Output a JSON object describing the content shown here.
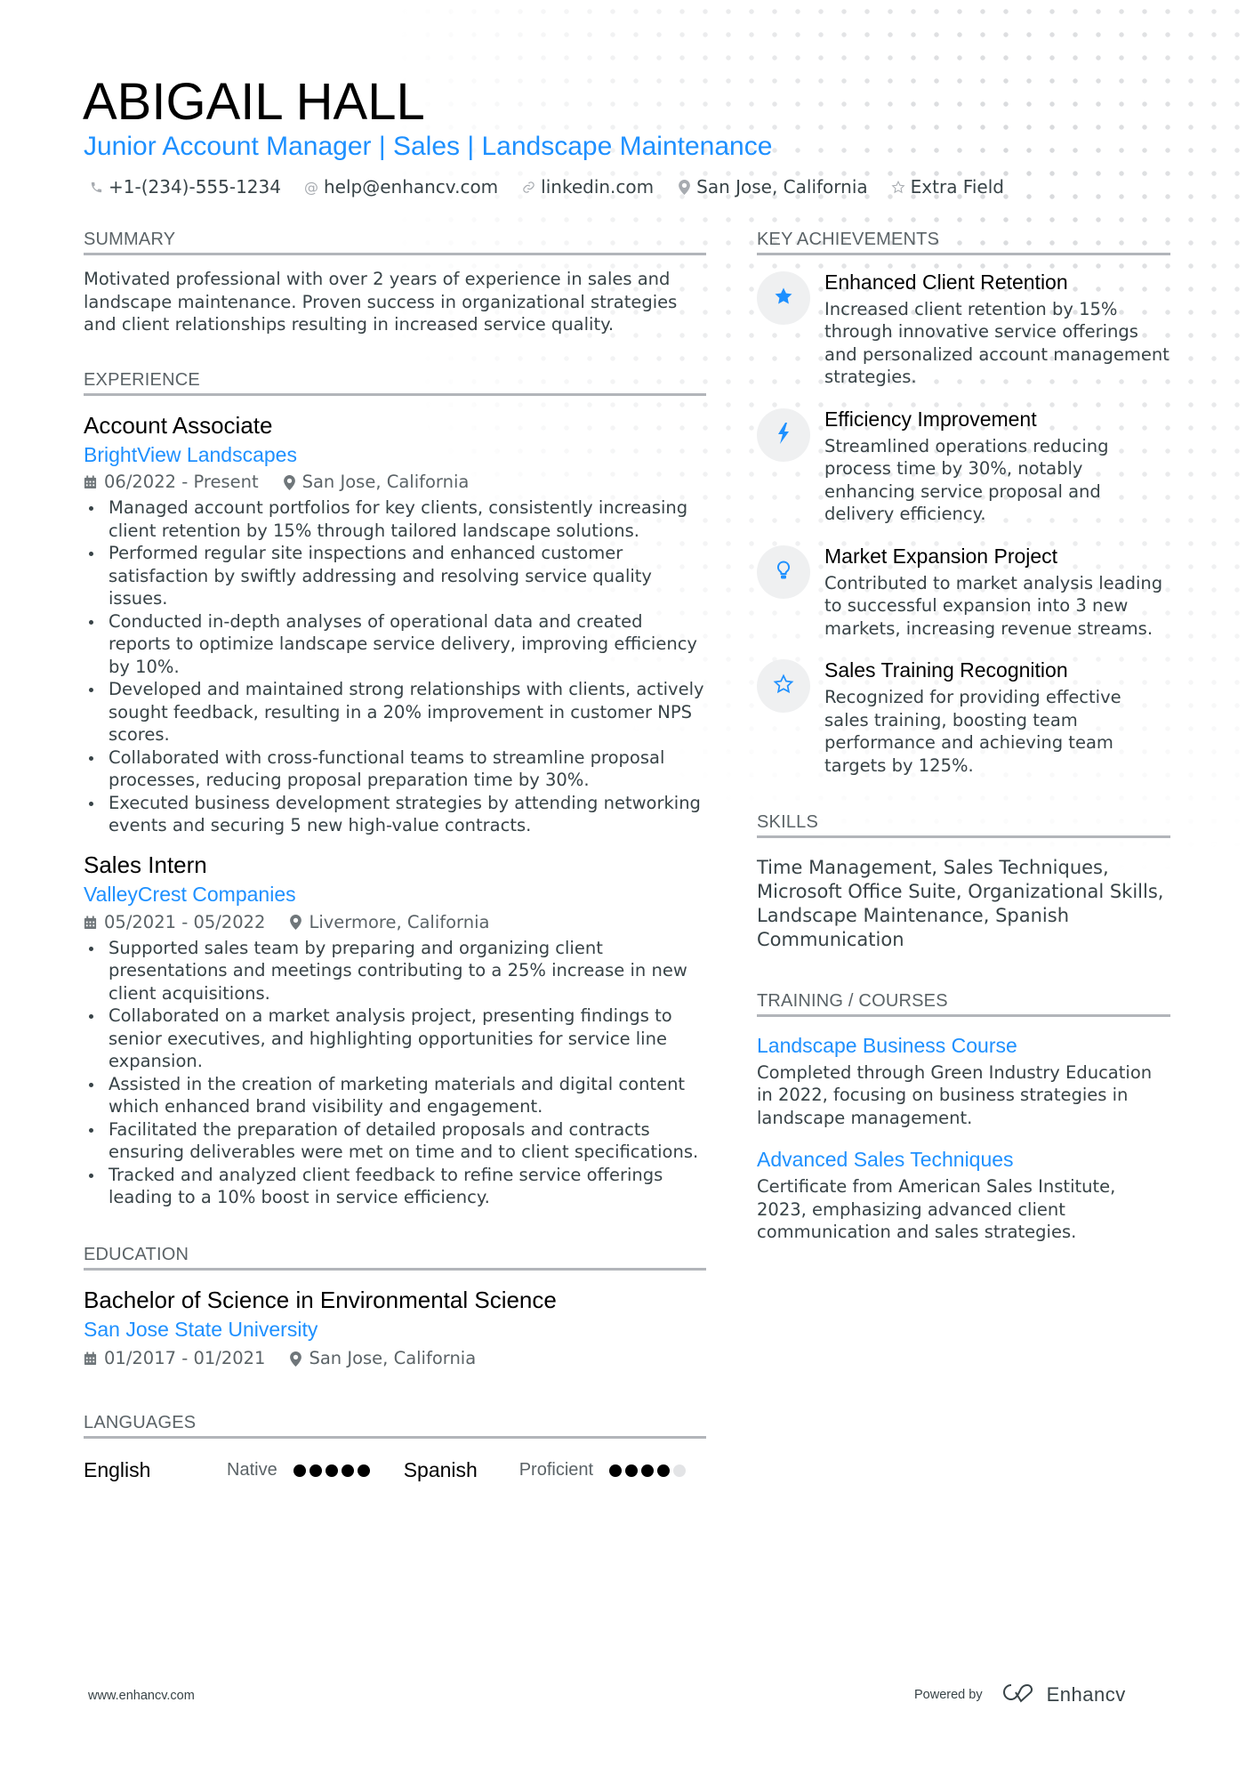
{
  "header": {
    "name": "ABIGAIL HALL",
    "title": "Junior Account Manager | Sales | Landscape Maintenance",
    "contacts": [
      {
        "icon": "phone-icon",
        "text": "+1-(234)-555-1234"
      },
      {
        "icon": "at-icon",
        "text": "help@enhancv.com"
      },
      {
        "icon": "link-icon",
        "text": "linkedin.com"
      },
      {
        "icon": "location-pin-icon",
        "text": "San Jose, California"
      },
      {
        "icon": "star-outline-icon",
        "text": "Extra Field"
      }
    ]
  },
  "summary": {
    "heading": "SUMMARY",
    "text": "Motivated professional with over 2 years of experience in sales and landscape maintenance. Proven success in organizational strategies and client relationships resulting in increased service quality."
  },
  "experience": {
    "heading": "EXPERIENCE",
    "jobs": [
      {
        "title": "Account Associate",
        "company": "BrightView Landscapes",
        "dates": "06/2022 - Present",
        "location": "San Jose, California",
        "bullets": [
          "Managed account portfolios for key clients, consistently increasing client retention by 15% through tailored landscape solutions.",
          "Performed regular site inspections and enhanced customer satisfaction by swiftly addressing and resolving service quality issues.",
          "Conducted in-depth analyses of operational data and created reports to optimize landscape service delivery, improving efficiency by 10%.",
          "Developed and maintained strong relationships with clients, actively sought feedback, resulting in a 20% improvement in customer NPS scores.",
          "Collaborated with cross-functional teams to streamline proposal processes, reducing proposal preparation time by 30%.",
          "Executed business development strategies by attending networking events and securing 5 new high-value contracts."
        ]
      },
      {
        "title": "Sales Intern",
        "company": "ValleyCrest Companies",
        "dates": "05/2021 - 05/2022",
        "location": "Livermore, California",
        "bullets": [
          "Supported sales team by preparing and organizing client presentations and meetings contributing to a 25% increase in new client acquisitions.",
          "Collaborated on a market analysis project, presenting findings to senior executives, and highlighting opportunities for service line expansion.",
          "Assisted in the creation of marketing materials and digital content which enhanced brand visibility and engagement.",
          "Facilitated the preparation of detailed proposals and contracts ensuring deliverables were met on time and to client specifications.",
          "Tracked and analyzed client feedback to refine service offerings leading to a 10% boost in service efficiency."
        ]
      }
    ]
  },
  "education": {
    "heading": "EDUCATION",
    "degree": "Bachelor of Science in Environmental Science",
    "school": "San Jose State University",
    "dates": "01/2017 - 01/2021",
    "location": "San Jose, California"
  },
  "languages": {
    "heading": "LANGUAGES",
    "items": [
      {
        "name": "English",
        "level": "Native",
        "rating": 5,
        "max": 5
      },
      {
        "name": "Spanish",
        "level": "Proficient",
        "rating": 4,
        "max": 5
      }
    ]
  },
  "achievements": {
    "heading": "KEY ACHIEVEMENTS",
    "items": [
      {
        "icon": "star-filled-icon",
        "title": "Enhanced Client Retention",
        "text": "Increased client retention by 15% through innovative service offerings and personalized account management strategies."
      },
      {
        "icon": "lightning-bolt-icon",
        "title": "Efficiency Improvement",
        "text": "Streamlined operations reducing process time by 30%, notably enhancing service proposal and delivery efficiency."
      },
      {
        "icon": "lightbulb-icon",
        "title": "Market Expansion Project",
        "text": "Contributed to market analysis leading to successful expansion into 3 new markets, increasing revenue streams."
      },
      {
        "icon": "star-outline-icon",
        "title": "Sales Training Recognition",
        "text": "Recognized for providing effective sales training, boosting team performance and achieving team targets by 125%."
      }
    ]
  },
  "skills": {
    "heading": "SKILLS",
    "text": "Time Management, Sales Techniques, Microsoft Office Suite, Organizational Skills, Landscape Maintenance, Spanish Communication"
  },
  "training": {
    "heading": "TRAINING / COURSES",
    "items": [
      {
        "title": "Landscape Business Course",
        "text": "Completed through Green Industry Education in 2022, focusing on business strategies in landscape management."
      },
      {
        "title": "Advanced Sales Techniques",
        "text": "Certificate from American Sales Institute, 2023, emphasizing advanced client communication and sales strategies."
      }
    ]
  },
  "footer": {
    "website": "www.enhancv.com",
    "powered_by": "Powered by",
    "brand": "Enhancv"
  },
  "colors": {
    "accent": "#1e90ff",
    "text": "#384347",
    "heading_rule": "#b2b5ba",
    "icon_circle": "#eff0f1"
  }
}
